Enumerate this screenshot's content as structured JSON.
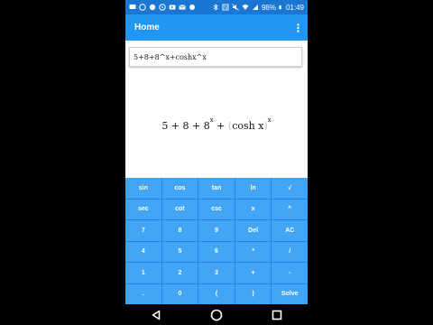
{
  "status_bar": {
    "battery": "98%",
    "time": "01:49",
    "left_icons": [
      "message-icon",
      "whatsapp-icon",
      "viber-icon",
      "skype-icon",
      "youtube-icon",
      "mail-icon",
      "more-icon"
    ],
    "right_icons": [
      "bluetooth-icon",
      "nfc-icon",
      "mute-icon",
      "wifi-icon",
      "signal-icon",
      "battery-icon"
    ]
  },
  "app_bar": {
    "title": "Home"
  },
  "expression": {
    "input_value": "5+8+8^x+coshx^x",
    "rendered": {
      "prefix": "5 + 8 + 8",
      "exp1": "x",
      "plus": " + ",
      "open_paren": "(",
      "function": "cosh x",
      "close_paren": ")",
      "exp2": "x"
    }
  },
  "keypad": {
    "rows": [
      [
        "sin",
        "cos",
        "tan",
        "ln",
        "√"
      ],
      [
        "sec",
        "cot",
        "csc",
        "x",
        "^"
      ],
      [
        "7",
        "8",
        "9",
        "Del",
        "AC"
      ],
      [
        "4",
        "5",
        "6",
        "*",
        "/"
      ],
      [
        "1",
        "2",
        "3",
        "+",
        "-"
      ],
      [
        ".",
        "0",
        "(",
        ")",
        "Solve"
      ]
    ]
  },
  "nav_bar": {
    "buttons": [
      "back-icon",
      "home-icon",
      "recents-icon"
    ]
  }
}
